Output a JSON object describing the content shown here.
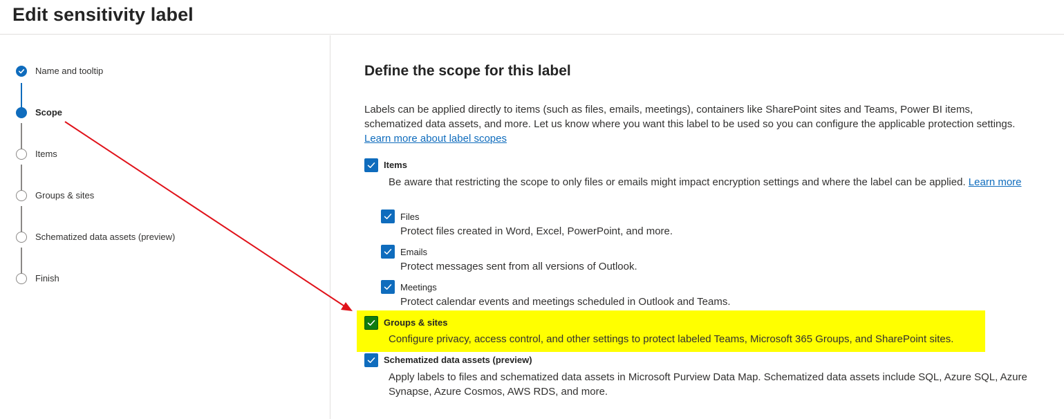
{
  "header": {
    "title": "Edit sensitivity label"
  },
  "steps": [
    {
      "label": "Name and tooltip",
      "state": "done"
    },
    {
      "label": "Scope",
      "state": "current"
    },
    {
      "label": "Items",
      "state": "pending"
    },
    {
      "label": "Groups & sites",
      "state": "pending"
    },
    {
      "label": "Schematized data assets (preview)",
      "state": "pending"
    },
    {
      "label": "Finish",
      "state": "pending"
    }
  ],
  "main": {
    "title": "Define the scope for this label",
    "intro": "Labels can be applied directly to items (such as files, emails, meetings), containers like SharePoint sites and Teams, Power BI items, schematized data assets, and more. Let us know where you want this label to be used so you can configure the applicable protection settings.",
    "intro_link": "Learn more about label scopes",
    "items": {
      "label": "Items",
      "checked": true,
      "description": "Be aware that restricting the scope to only files or emails might impact encryption settings and where the label can be applied.",
      "link": "Learn more",
      "sub_options": [
        {
          "label": "Files",
          "checked": true,
          "description": "Protect files created in Word, Excel, PowerPoint, and more."
        },
        {
          "label": "Emails",
          "checked": true,
          "description": "Protect messages sent from all versions of Outlook."
        },
        {
          "label": "Meetings",
          "checked": true,
          "description": "Protect calendar events and meetings scheduled in Outlook and Teams."
        }
      ]
    },
    "groups_sites": {
      "label": "Groups & sites",
      "checked": true,
      "description": "Configure privacy, access control, and other settings to protect labeled Teams, Microsoft 365 Groups, and SharePoint sites."
    },
    "schematized": {
      "label": "Schematized data assets (preview)",
      "checked": true,
      "description": "Apply labels to files and schematized data assets in Microsoft Purview Data Map. Schematized data assets include SQL, Azure SQL, Azure Synapse, Azure Cosmos, AWS RDS, and more."
    }
  },
  "colors": {
    "accent": "#0f6cbd",
    "highlight": "#ffff00",
    "highlight_checkbox": "#107c10",
    "annotation_arrow": "#e0121a"
  },
  "icons": {
    "step_done": "checkmark-icon",
    "checkbox": "checkmark-icon",
    "annotation": "red-arrow"
  }
}
